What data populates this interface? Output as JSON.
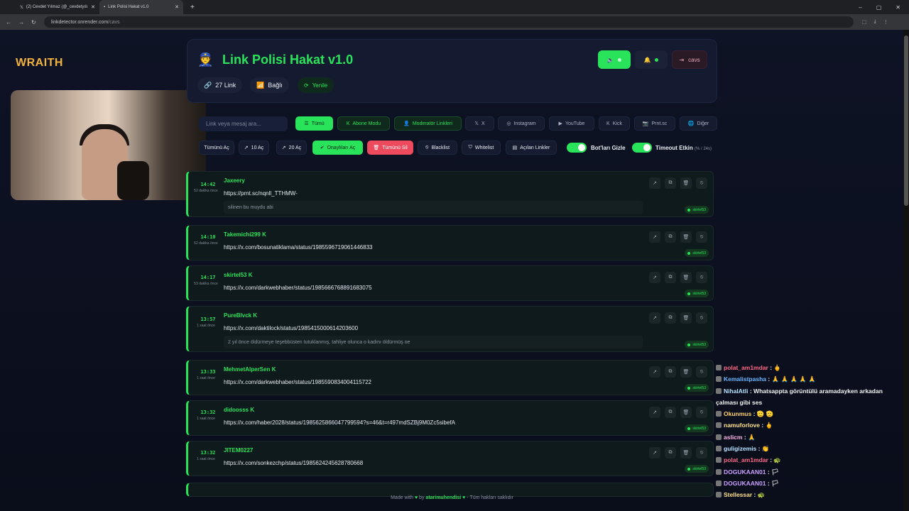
{
  "browser": {
    "tabs": [
      {
        "label": "(2) Cevdet Yılmaz (@_cevdetyılı",
        "icon": "x-logo-icon"
      },
      {
        "label": "Link Polisi Hakat v1.0",
        "icon": "page-icon"
      }
    ],
    "url_host": "linkdetector.onrender.com",
    "url_path": "/cavs"
  },
  "overlay": {
    "brand": "WRAITH"
  },
  "app": {
    "title": "Link Polisi Hakat v1.0",
    "stats": {
      "link_count_label": "27 Link",
      "connection_label": "Bağlı",
      "refresh_label": "Yenile"
    },
    "user_label": "cavs",
    "search_placeholder": "Link veya mesaj ara...",
    "filters": [
      "Tümü",
      "Abone Modu",
      "Moderatör Linkleri",
      "X",
      "Instagram",
      "YouTube",
      "Kick",
      "Prnt.sc",
      "Diğer"
    ],
    "actions": [
      "Tümünü Aç",
      "10 Aç",
      "20 Aç",
      "Onaylıları Aç",
      "Tümünü Sil",
      "Blacklist",
      "Whitelist",
      "Açılan Linkler"
    ],
    "toggles": {
      "hide_bots": "Bot'ları Gizle",
      "timeout": "Timeout Etkin",
      "timeout_hint": "(% / 24s)"
    }
  },
  "links": [
    {
      "time": "14:42",
      "ago": "52 dakika önce",
      "user": "Jaxeery",
      "url": "https://prnt.sc/nqnll_TTHMW-",
      "message": "silinen bu muydu abi",
      "badge": "skirtel53"
    },
    {
      "time": "14:10",
      "ago": "52 dakika önce",
      "user": "Takemichi299 K",
      "url": "https://x.com/bosunatiklama/status/1985596719061446833",
      "message": "",
      "badge": "skirtel53"
    },
    {
      "time": "14:17",
      "ago": "53 dakika önce",
      "user": "skirtel53 K",
      "url": "https://x.com/darkwebhaber/status/1985666768891683075",
      "message": "",
      "badge": "skirtel53"
    },
    {
      "time": "13:57",
      "ago": "1 saat önce",
      "user": "PureBlvck K",
      "url": "https://x.com/daktilock/status/1985415000614203600",
      "message": "2 yıl önce öldürmeye teşebbüsten tutuklanmış, tahliye olunca o kadını öldürmüş oe",
      "badge": "skirtel53"
    },
    {
      "time": "13:33",
      "ago": "1 saat önce",
      "user": "MehmetAlperSen K",
      "url": "https://x.com/darkwebhaber/status/1985590834004115722",
      "message": "",
      "badge": "skirtel53"
    },
    {
      "time": "13:32",
      "ago": "1 saat önce",
      "user": "didoosss K",
      "url": "https://x.com/haber2028/status/1985625866047799594?s=46&t=r497mdSZBj9M0Zc5sibefA",
      "message": "",
      "badge": "skirtel53"
    },
    {
      "time": "13:32",
      "ago": "1 saat önce",
      "user": "JITEM0227",
      "url": "https://x.com/sonkezchp/status/1985624245628780668",
      "message": "",
      "badge": "skirtel53"
    }
  ],
  "chat": [
    {
      "user": "polat_am1mdar",
      "text": ": 🖕"
    },
    {
      "user": "Kemalistpasha",
      "text": ": 🙏 🙏 🙏 🙏 🙏"
    },
    {
      "user": "NihalAtli",
      "text": ": Whatsappta görüntülü aramadayken arkadan çalması gibi ses"
    },
    {
      "user": "Okunmus",
      "text": ": 🫡 🫡"
    },
    {
      "user": "namuforlove",
      "text": ": 🖕"
    },
    {
      "user": "aslicm",
      "text": ": 🙏"
    },
    {
      "user": "guligizemis",
      "text": ": 👏"
    },
    {
      "user": "polat_am1mdar",
      "text": ": 🐢"
    },
    {
      "user": "DOGUKAAN01",
      "text": ": 🏳"
    },
    {
      "user": "DOGUKAAN01",
      "text": ": 🏳"
    },
    {
      "user": "Stellessar",
      "text": ": 🐢"
    }
  ],
  "footer": {
    "made_with": "Made with",
    "by": "by",
    "author": "atarimuhendisi",
    "rights": "- Tüm hakları saklıdır"
  }
}
